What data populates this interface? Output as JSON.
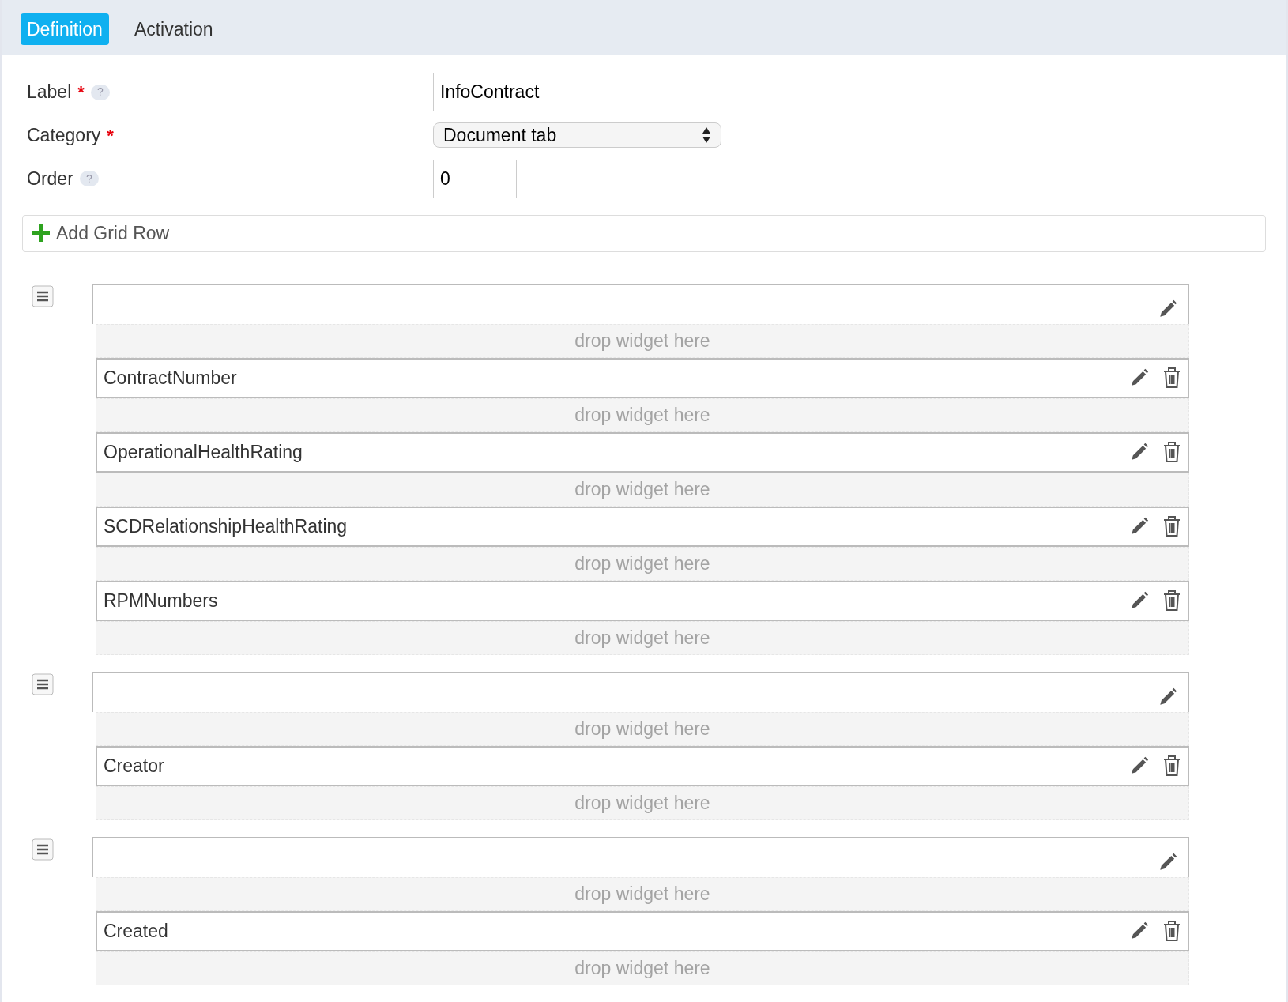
{
  "tabs": [
    {
      "label": "Definition",
      "selected": true
    },
    {
      "label": "Activation",
      "selected": false
    }
  ],
  "fields": [
    {
      "label": "Label",
      "required_mark": "*",
      "help": "?",
      "kind": "input",
      "value": "InfoContract"
    },
    {
      "label": "Category",
      "required_mark": "*",
      "kind": "select",
      "value": "Document tab"
    },
    {
      "label": "Order",
      "help": "?",
      "kind": "input-small",
      "value": "0"
    }
  ],
  "add_grid_row": {
    "label": "Add Grid Row"
  },
  "grid_rows": [
    {
      "items": [
        {
          "kind": "drop",
          "text": "drop widget here"
        },
        {
          "kind": "widget",
          "label": "ContractNumber"
        },
        {
          "kind": "drop",
          "text": "drop widget here"
        },
        {
          "kind": "widget",
          "label": "OperationalHealthRating"
        },
        {
          "kind": "drop",
          "text": "drop widget here"
        },
        {
          "kind": "widget",
          "label": "SCDRelationshipHealthRating"
        },
        {
          "kind": "drop",
          "text": "drop widget here"
        },
        {
          "kind": "widget",
          "label": "RPMNumbers"
        },
        {
          "kind": "drop",
          "text": "drop widget here"
        }
      ]
    },
    {
      "items": [
        {
          "kind": "drop",
          "text": "drop widget here"
        },
        {
          "kind": "widget",
          "label": "Creator"
        },
        {
          "kind": "drop",
          "text": "drop widget here"
        }
      ]
    },
    {
      "items": [
        {
          "kind": "drop",
          "text": "drop widget here"
        },
        {
          "kind": "widget",
          "label": "Created"
        },
        {
          "kind": "drop",
          "text": "drop widget here"
        }
      ]
    }
  ]
}
